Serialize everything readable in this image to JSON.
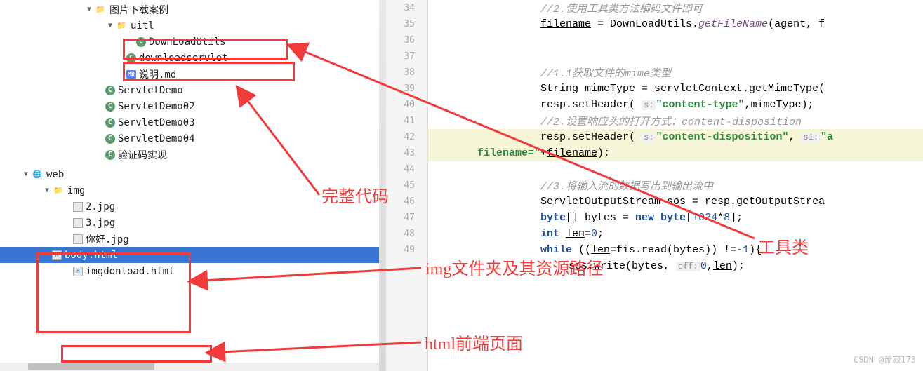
{
  "tree": {
    "root1": "图片下载案例",
    "uitl": "uitl",
    "downloadutils": "DownLoadUtils",
    "downloadservlet": "downloadservlet",
    "shuoming": "说明.md",
    "servletdemo": "ServletDemo",
    "servletdemo02": "ServletDemo02",
    "servletdemo03": "ServletDemo03",
    "servletdemo04": "ServletDemo04",
    "yanzhengma": "验证码实现",
    "web": "web",
    "img": "img",
    "img2": "2.jpg",
    "img3": "3.jpg",
    "imgnh": "你好.jpg",
    "bodyhtml": "body.html",
    "imgdownload": "imgdonload.html"
  },
  "gutter": [
    "34",
    "35",
    "36",
    "37",
    "38",
    "39",
    "40",
    "41",
    "42",
    "43",
    "44",
    "45",
    "46",
    "47",
    "48",
    "49"
  ],
  "code": {
    "c1": "//2.使用工具类方法编码文件即可",
    "c2a": "filename",
    "c2b": " = DownLoadUtils.",
    "c2c": "getFileName",
    "c2d": "(agent, f",
    "c6": "//1.1获取文件的mime类型",
    "c7a": "String mimeType = servletContext.getMimeType(",
    "c8a": "resp.setHeader( ",
    "c8p": "s:",
    "c8b": "\"content-type\"",
    "c8c": ",mimeType);",
    "c9": "//2.设置响应头的打开方式：content-disposition",
    "c10a": "resp.setHeader( ",
    "c10p": "s:",
    "c10b": "\"content-disposition\"",
    "c10c": ", ",
    "c10p2": "s1:",
    "c10d": "\"a",
    "c11a": "filename=\"",
    "c11b": "+",
    "c11c": "filename",
    "c11d": ");",
    "c13": "//3.将输入流的数据写出到输出流中",
    "c14a": "ServletOutputStream sos = resp.getOutputStrea",
    "c15a": "byte",
    "c15b": "[] bytes = ",
    "c15c": "new byte",
    "c15d": "[",
    "c15e": "1024",
    "c15f": "*",
    "c15g": "8",
    "c15h": "];",
    "c16a": "int ",
    "c16b": "len",
    "c16c": "=",
    "c16d": "0",
    "c16e": ";",
    "c17a": "while",
    "c17b": " ((",
    "c17c": "len",
    "c17d": "=fis.read(bytes)) !=-",
    "c17e": "1",
    "c17f": "){",
    "c18a": "sos.write(bytes, ",
    "c18p": "off:",
    "c18b": "0",
    "c18c": ",",
    "c18d": "len",
    "c18e": ");"
  },
  "annotations": {
    "a1": "完整代码",
    "a2": "工具类",
    "a3": "img文件夹及其资源路径",
    "a4": "html前端页面"
  },
  "watermark": "CSDN @萧寂173"
}
